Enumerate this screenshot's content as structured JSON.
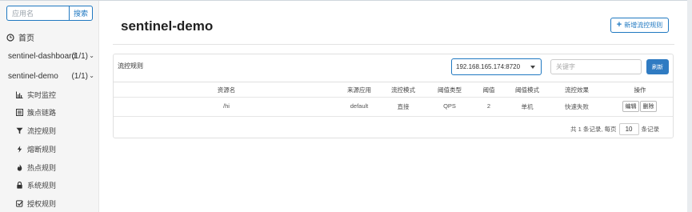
{
  "sidebar": {
    "search": {
      "placeholder": "应用名",
      "button_label": "搜索"
    },
    "home_label": "首页",
    "apps": [
      {
        "name": "sentinel-dashboard",
        "count": "(1/1)"
      },
      {
        "name": "sentinel-demo",
        "count": "(1/1)"
      }
    ],
    "menu": [
      {
        "label": "实时监控",
        "icon": "bar-chart-icon"
      },
      {
        "label": "簇点链路",
        "icon": "list-icon"
      },
      {
        "label": "流控规则",
        "icon": "filter-icon"
      },
      {
        "label": "熔断规则",
        "icon": "flash-icon"
      },
      {
        "label": "热点规则",
        "icon": "fire-icon"
      },
      {
        "label": "系统规则",
        "icon": "lock-icon"
      },
      {
        "label": "授权规则",
        "icon": "check-icon"
      }
    ]
  },
  "main": {
    "title": "sentinel-demo",
    "add_button_label": "新增流控规则",
    "panel": {
      "title": "流控规则",
      "machine": "192.168.165.174:8720",
      "keyword_placeholder": "关键字",
      "refresh_label": "刷新",
      "columns": [
        "资源名",
        "来源应用",
        "流控模式",
        "阈值类型",
        "阈值",
        "阈值模式",
        "流控效果",
        "操作"
      ],
      "rows": [
        {
          "resource": "/hi",
          "origin": "default",
          "mode": "直接",
          "grade": "QPS",
          "threshold": "2",
          "cluster_mode": "单机",
          "effect": "快速失败",
          "edit": "编辑",
          "delete": "删除"
        }
      ],
      "pager": {
        "prefix": "共 1 条记录, 每页",
        "page_size": "10",
        "suffix": "条记录"
      }
    }
  },
  "colors": {
    "accent": "#1f78c1",
    "refresh_bg": "#2f7bc2",
    "sidebar_bg": "#f5f5f5"
  }
}
